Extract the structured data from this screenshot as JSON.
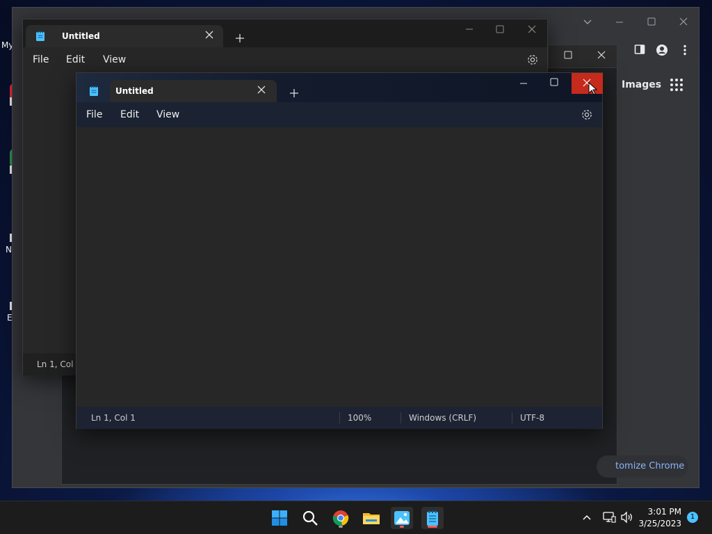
{
  "desktop": {
    "icon_labels": [
      "My",
      "N",
      "E"
    ]
  },
  "chrome": {
    "images_label": "Images",
    "customize_label": "tomize Chrome"
  },
  "notepad_back": {
    "tab_title": "Untitled",
    "menu": {
      "file": "File",
      "edit": "Edit",
      "view": "View"
    },
    "status_position": "Ln 1, Col 1"
  },
  "notepad_front": {
    "tab_title": "Untitled",
    "menu": {
      "file": "File",
      "edit": "Edit",
      "view": "View"
    },
    "editor_text": "",
    "status": {
      "position": "Ln 1, Col 1",
      "zoom": "100%",
      "line_ending": "Windows (CRLF)",
      "encoding": "UTF-8"
    }
  },
  "taskbar": {
    "icons": [
      "start-icon",
      "search-icon",
      "chrome-icon",
      "file-explorer-icon",
      "photos-icon",
      "notepad-icon"
    ],
    "time": "3:01 PM",
    "date": "3/25/2023",
    "notification_count": "1"
  },
  "colors": {
    "close_hover": "#c42b1c",
    "accent": "#4cc2ff",
    "chrome_link": "#8ab4f8"
  }
}
